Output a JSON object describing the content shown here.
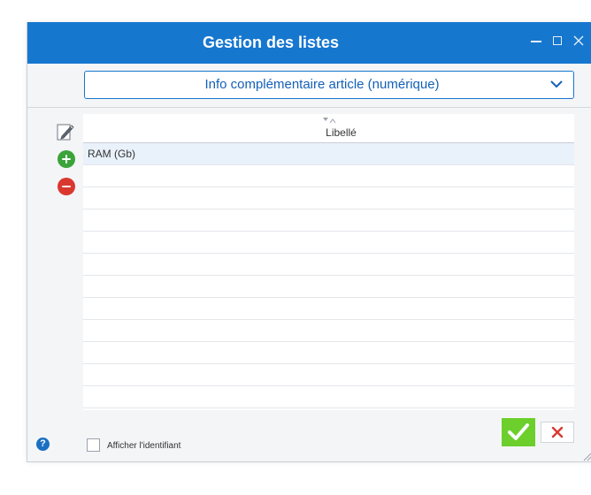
{
  "window": {
    "title": "Gestion des listes"
  },
  "selector": {
    "value": "Info complémentaire article (numérique)"
  },
  "grid": {
    "column_header": "Libellé",
    "rows": [
      "RAM (Gb)",
      "",
      "",
      "",
      "",
      "",
      "",
      "",
      "",
      "",
      "",
      ""
    ]
  },
  "footer": {
    "checkbox_label": "Afficher l'identifiant",
    "help_icon_glyph": "?"
  },
  "icons": {
    "edit": "edit-pencil-icon",
    "add": "plus-circle-icon",
    "remove": "minus-circle-icon",
    "sort": "sort-filter-icon",
    "ok": "checkmark-icon",
    "cancel": "close-x-icon"
  },
  "colors": {
    "titlebar": "#1677cf",
    "accent_text": "#1460b8",
    "add": "#3ba33a",
    "remove": "#d9382f",
    "ok": "#6ccf2c",
    "cancel_x": "#d9382f"
  }
}
